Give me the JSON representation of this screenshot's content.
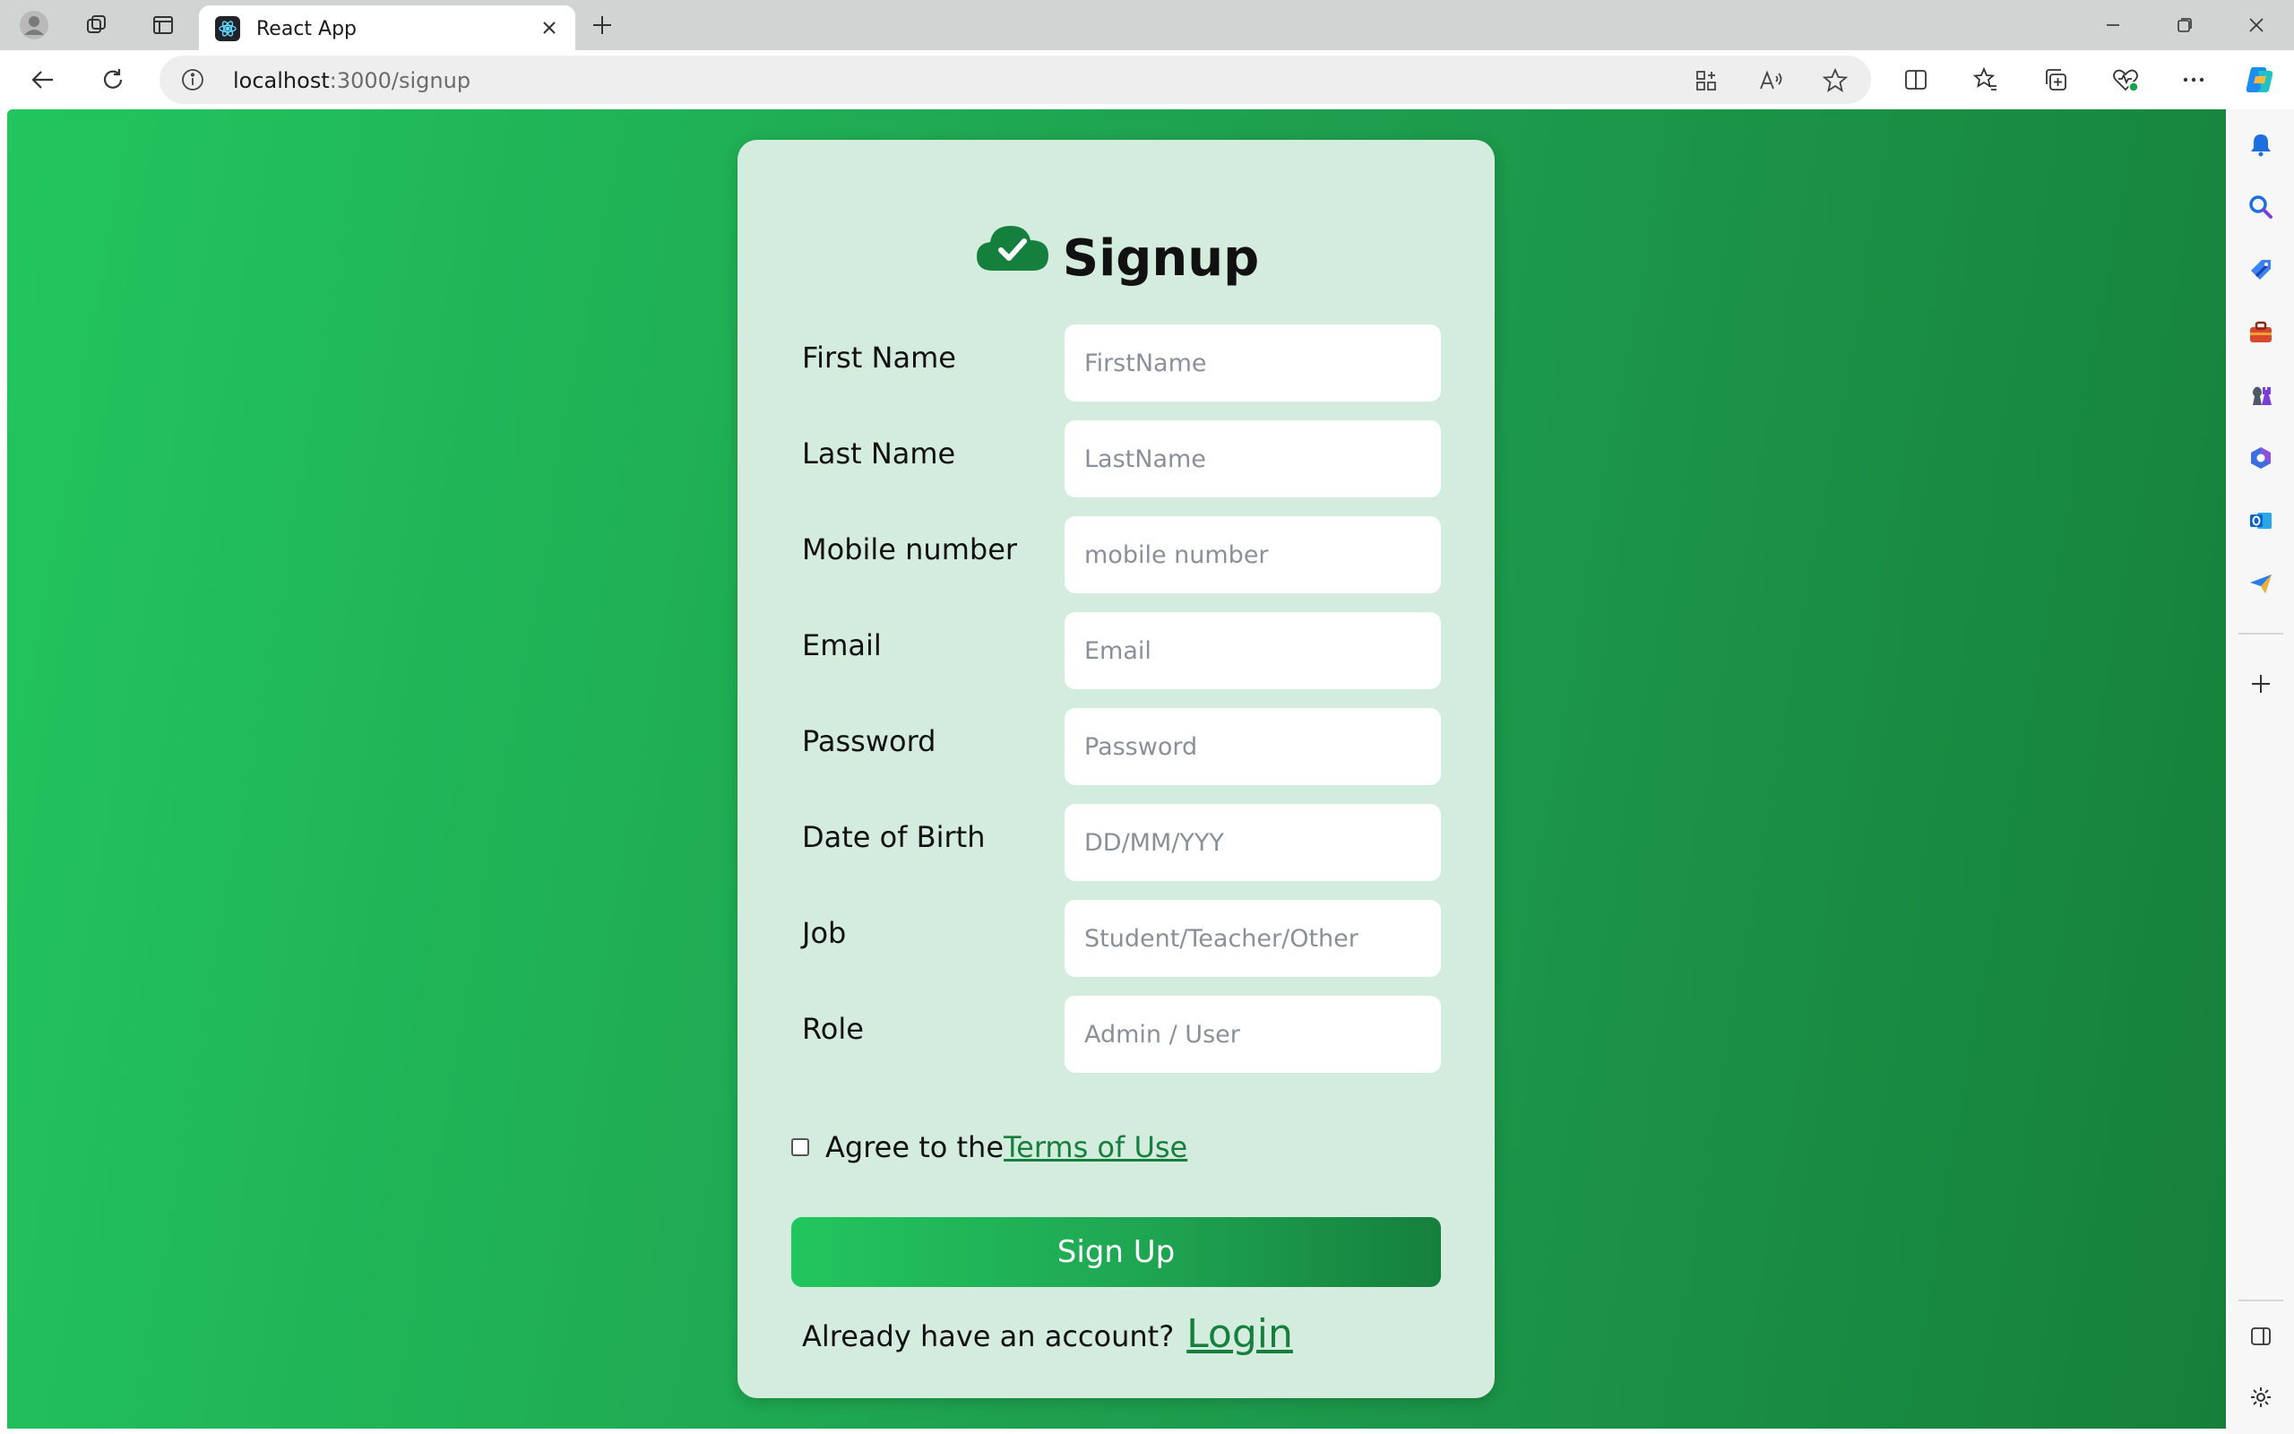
{
  "browser": {
    "tab": {
      "title": "React App"
    },
    "address": {
      "host": "localhost",
      "path": ":3000/signup"
    }
  },
  "icons": {
    "tabbar": [
      "profile-icon",
      "workspaces-icon",
      "tab-actions-icon",
      "react-favicon-icon",
      "close-tab-icon",
      "new-tab-icon",
      "minimize-icon",
      "maximize-icon",
      "close-window-icon"
    ],
    "toolbar": [
      "back-icon",
      "refresh-icon",
      "site-info-icon",
      "app-available-icon",
      "read-aloud-icon",
      "add-favorite-icon",
      "split-screen-icon",
      "favorites-icon",
      "collections-icon",
      "browser-essentials-icon",
      "more-icon",
      "copilot-icon"
    ],
    "sidebar": [
      "bell-icon",
      "search-icon",
      "shopping-tag-icon",
      "tools-icon",
      "games-icon",
      "microsoft-365-icon",
      "outlook-icon",
      "send-icon",
      "add-icon",
      "hide-sidebar-icon",
      "settings-icon"
    ]
  },
  "signup": {
    "title": "Signup",
    "fields": [
      {
        "label": "First Name",
        "placeholder": "FirstName"
      },
      {
        "label": "Last Name",
        "placeholder": "LastName"
      },
      {
        "label": "Mobile number",
        "placeholder": "mobile number"
      },
      {
        "label": "Email",
        "placeholder": "Email"
      },
      {
        "label": "Password",
        "placeholder": "Password"
      },
      {
        "label": "Date of Birth",
        "placeholder": "DD/MM/YYY"
      },
      {
        "label": "Job",
        "placeholder": "Student/Teacher/Other"
      },
      {
        "label": "Role",
        "placeholder": "Admin / User"
      }
    ],
    "agree_text": "Agree to the",
    "terms_link": "Terms of Use",
    "submit_label": "Sign Up",
    "login_prompt": "Already have an account?",
    "login_link": "Login"
  },
  "colors": {
    "accent": "#15803d",
    "gradient_start": "#22c55e",
    "gradient_end": "#15803d",
    "card_background": "#d3ecdd"
  }
}
